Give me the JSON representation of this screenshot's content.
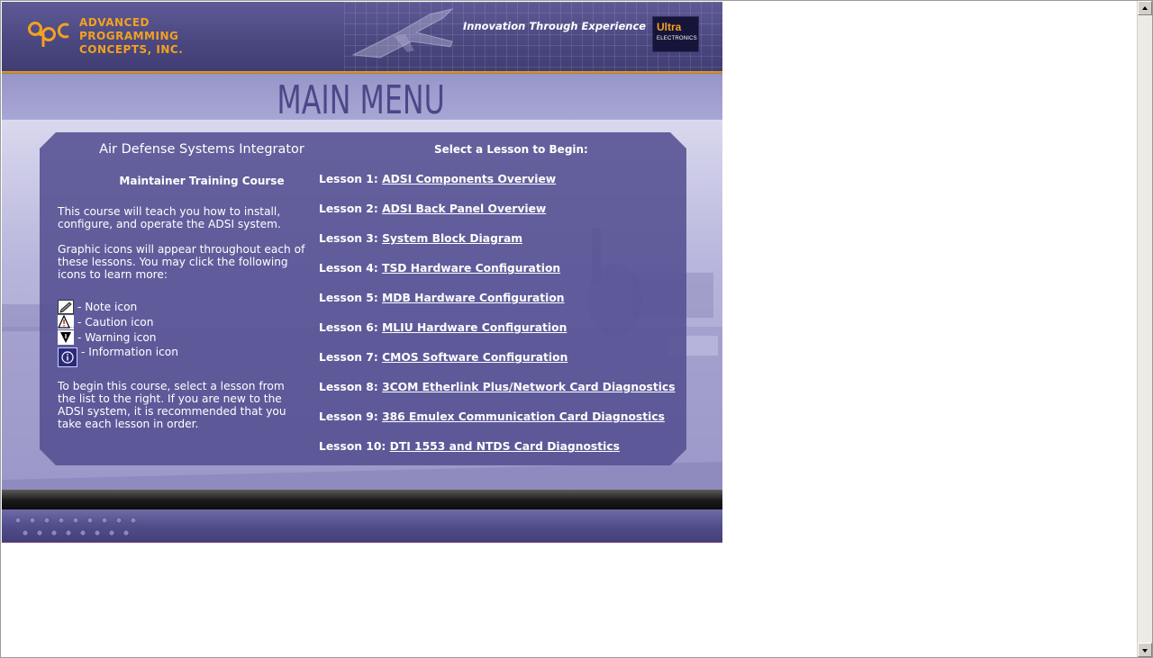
{
  "header": {
    "logo_lines": [
      "ADVANCED",
      "PROGRAMMING",
      "CONCEPTS, INC."
    ],
    "tagline": "Innovation Through Experience",
    "badge_brand": "Ultra",
    "badge_sub": "ELECTRONICS"
  },
  "page_title": "MAIN MENU",
  "left": {
    "course_title": "Air Defense Systems Integrator",
    "course_subtitle": "Maintainer Training Course",
    "intro_lines": [
      "This course will teach you how to install,",
      "configure, and operate the ADSI system."
    ],
    "icons_lines": [
      "Graphic icons will appear throughout each of",
      "these lessons. You may click the following",
      "icons to learn more:"
    ],
    "icons": [
      {
        "label": "- Note icon",
        "icon": "note-icon"
      },
      {
        "label": "- Caution icon",
        "icon": "caution-icon"
      },
      {
        "label": "- Warning icon",
        "icon": "warning-icon"
      },
      {
        "label": "- Information icon",
        "icon": "information-icon"
      }
    ],
    "begin_lines": [
      "To begin this course, select a lesson from",
      "the list to the right. If you are new to the",
      "ADSI system, it is recommended that you",
      "take each lesson in order."
    ]
  },
  "right": {
    "title": "Select a Lesson to Begin:",
    "lessons": [
      {
        "prefix": "Lesson 1:",
        "title": "ADSI Components Overview"
      },
      {
        "prefix": "Lesson 2:",
        "title": "ADSI Back Panel Overview"
      },
      {
        "prefix": "Lesson 3:",
        "title": "System Block Diagram"
      },
      {
        "prefix": "Lesson 4:",
        "title": "TSD Hardware Configuration"
      },
      {
        "prefix": "Lesson 5:",
        "title": "MDB Hardware Configuration"
      },
      {
        "prefix": "Lesson 6:",
        "title": "MLIU Hardware Configuration"
      },
      {
        "prefix": "Lesson 7:",
        "title": "CMOS Software Configuration"
      },
      {
        "prefix": "Lesson 8:",
        "title": "3COM Etherlink Plus/Network Card Diagnostics"
      },
      {
        "prefix": "Lesson 9:",
        "title": "386 Emulex Communication Card Diagnostics"
      },
      {
        "prefix": "Lesson 10:",
        "title": "DTI 1553 and NTDS Card Diagnostics"
      }
    ]
  },
  "colors": {
    "accent_orange": "#f4a11f",
    "panel_purple": "#545092",
    "title_purple": "#4b4889"
  }
}
